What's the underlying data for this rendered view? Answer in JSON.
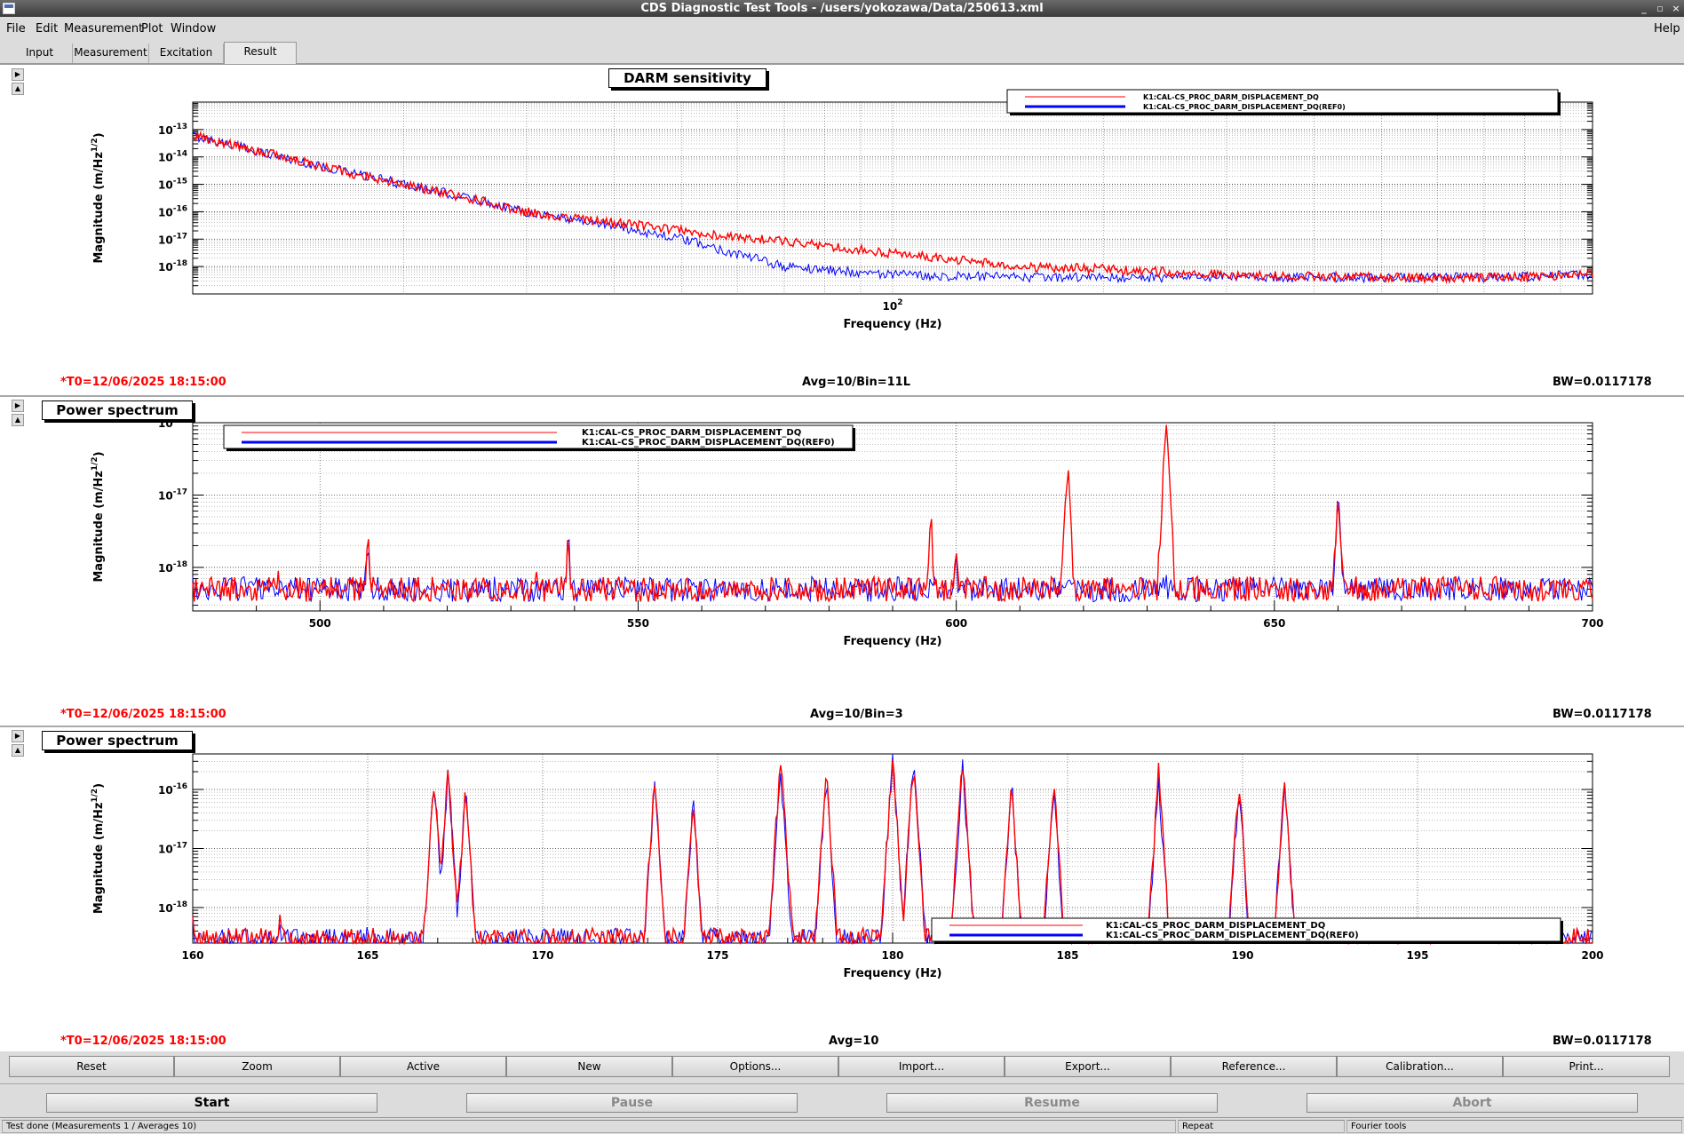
{
  "window": {
    "title": "CDS Diagnostic Test Tools - /users/yokozawa/Data/250613.xml",
    "minimize": "_",
    "maximize": "▫",
    "close": "×"
  },
  "menu": [
    "File",
    "Edit",
    "Measurement",
    "Plot",
    "Window"
  ],
  "menu_help": "Help",
  "tabs": [
    "Input",
    "Measurement",
    "Excitation",
    "Result"
  ],
  "active_tab": "Result",
  "legend": {
    "series": [
      "K1:CAL-CS_PROC_DARM_DISPLACEMENT_DQ",
      "K1:CAL-CS_PROC_DARM_DISPLACEMENT_DQ(REF0)"
    ],
    "colors": [
      "#ff0000",
      "#0000ff"
    ]
  },
  "plots": [
    {
      "title": "DARM sensitivity",
      "xlabel": "Frequency (Hz)",
      "ylabel": "Magnitude (m/Hz^1/2)",
      "t0": "*T0=12/06/2025 18:15:00",
      "avg": "Avg=10/Bin=11L",
      "bw": "BW=0.0117178",
      "chart_data": {
        "type": "line",
        "x_scale": "log",
        "y_scale": "log",
        "xlim": [
          10,
          1000
        ],
        "ylim": [
          1e-19,
          1e-12
        ],
        "x_ticks": [
          "10^2"
        ],
        "y_ticks": [
          "10^-13",
          "10^-14",
          "10^-15",
          "10^-16",
          "10^-17",
          "10^-18"
        ],
        "grid": true,
        "legend_position": "top-right",
        "series": [
          {
            "name": "K1:CAL-CS_PROC_DARM_DISPLACEMENT_DQ",
            "color": "#ff0000",
            "x": [
              10,
              12,
              15,
              20,
              25,
              30,
              40,
              50,
              70,
              100,
              150,
              200,
              300,
              500,
              700,
              1000
            ],
            "y": [
              6e-14,
              2e-14,
              5e-15,
              1e-15,
              3e-16,
              1e-16,
              4e-17,
              2e-17,
              8e-18,
              3e-18,
              1e-18,
              8e-19,
              5e-19,
              4e-19,
              4e-19,
              5e-19
            ]
          },
          {
            "name": "K1:CAL-CS_PROC_DARM_DISPLACEMENT_DQ(REF0)",
            "color": "#0000ff",
            "x": [
              10,
              12,
              15,
              20,
              25,
              30,
              40,
              50,
              70,
              100,
              150,
              200,
              300,
              500,
              700,
              1000
            ],
            "y": [
              6e-14,
              2e-14,
              5e-15,
              1e-15,
              3e-16,
              1e-16,
              3e-17,
              1e-17,
              1e-18,
              5e-19,
              4e-19,
              4e-19,
              4e-19,
              4e-19,
              4e-19,
              5e-19
            ]
          }
        ]
      }
    },
    {
      "title": "Power spectrum",
      "xlabel": "Frequency (Hz)",
      "ylabel": "Magnitude (m/Hz^1/2)",
      "t0": "*T0=12/06/2025 18:15:00",
      "avg": "Avg=10/Bin=3",
      "bw": "BW=0.0117178",
      "chart_data": {
        "type": "line",
        "x_scale": "linear",
        "y_scale": "log",
        "xlim": [
          480,
          700
        ],
        "ylim": [
          2.5e-19,
          1e-16
        ],
        "x_ticks": [
          "500",
          "550",
          "600",
          "650",
          "700"
        ],
        "y_ticks": [
          "10^-16",
          "10^-17",
          "10^-18"
        ],
        "grid": true,
        "legend_position": "top-left",
        "series": [
          {
            "name": "K1:CAL-CS_PROC_DARM_DISPLACEMENT_DQ",
            "color": "#ff0000",
            "x": [
              480,
              493.5,
              507.5,
              515,
              534,
              539,
              596,
              600,
              617.5,
              633,
              660,
              700
            ],
            "y": [
              5e-19,
              1e-18,
              3e-18,
              6e-19,
              9e-19,
              3e-18,
              5e-18,
              2e-18,
              2.5e-17,
              1e-16,
              1e-17,
              5e-19
            ]
          },
          {
            "name": "K1:CAL-CS_PROC_DARM_DISPLACEMENT_DQ(REF0)",
            "color": "#0000ff",
            "x": [
              480,
              493.5,
              507.5,
              515,
              534,
              539,
              596,
              600,
              617.5,
              633,
              660,
              700
            ],
            "y": [
              5e-19,
              4e-19,
              3e-18,
              6e-19,
              9e-19,
              3e-18,
              4e-19,
              1.5e-18,
              1.1e-18,
              1e-18,
              1e-17,
              5e-19
            ]
          }
        ]
      }
    },
    {
      "title": "Power spectrum",
      "xlabel": "Frequency (Hz)",
      "ylabel": "Magnitude (m/Hz^1/2)",
      "t0": "*T0=12/06/2025 18:15:00",
      "avg": "Avg=10",
      "bw": "BW=0.0117178",
      "chart_data": {
        "type": "line",
        "x_scale": "linear",
        "y_scale": "log",
        "xlim": [
          160,
          200
        ],
        "ylim": [
          2.5e-19,
          4e-16
        ],
        "x_ticks": [
          "160",
          "165",
          "170",
          "175",
          "180",
          "185",
          "190",
          "195",
          "200"
        ],
        "y_ticks": [
          "10^-16",
          "10^-17",
          "10^-18"
        ],
        "grid": true,
        "legend_position": "bottom-right",
        "series": [
          {
            "name": "K1:CAL-CS_PROC_DARM_DISPLACEMENT_DQ",
            "color": "#ff0000",
            "x": [
              160,
              162.5,
              165,
              166.9,
              167.3,
              167.8,
              173.2,
              174.3,
              176.8,
              178.1,
              180,
              180.6,
              182,
              183.4,
              184.6,
              187.6,
              189.9,
              191.2,
              196.5,
              200
            ],
            "y": [
              5e-19,
              9e-19,
              6e-19,
              1.5e-16,
              2e-16,
              1e-16,
              1.5e-16,
              7e-17,
              3.5e-16,
              2e-16,
              3.5e-16,
              3e-16,
              3e-16,
              1.5e-16,
              1.5e-16,
              2e-16,
              1.5e-16,
              1.5e-16,
              5e-19,
              3e-19
            ]
          },
          {
            "name": "K1:CAL-CS_PROC_DARM_DISPLACEMENT_DQ(REF0)",
            "color": "#0000ff",
            "x": [
              160,
              162.5,
              165,
              166.9,
              167.3,
              167.8,
              173.2,
              174.3,
              176.8,
              178.1,
              180,
              180.6,
              182,
              183.4,
              184.6,
              187.6,
              189.9,
              191.2,
              196.5,
              200
            ],
            "y": [
              5e-19,
              8e-19,
              5e-19,
              1.5e-16,
              2e-16,
              1e-16,
              1.2e-16,
              6e-17,
              2e-16,
              1.5e-16,
              3e-16,
              3.5e-16,
              2.5e-16,
              1.2e-16,
              1.2e-16,
              1.5e-16,
              1.2e-16,
              1.5e-16,
              4e-19,
              3e-19
            ]
          }
        ]
      }
    }
  ],
  "toolbar": [
    "Reset",
    "Zoom",
    "Active",
    "New",
    "Options...",
    "Import...",
    "Export...",
    "Reference...",
    "Calibration...",
    "Print..."
  ],
  "controls": [
    "Start",
    "Pause",
    "Resume",
    "Abort"
  ],
  "status": {
    "message": "Test done (Measurements 1 / Averages 10)",
    "repeat": "Repeat",
    "fourier": "Fourier tools"
  }
}
